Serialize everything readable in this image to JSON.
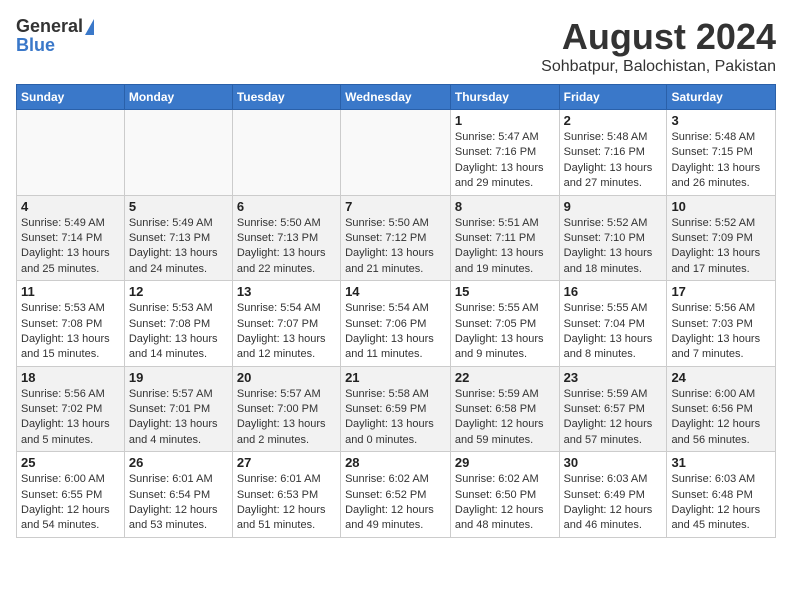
{
  "logo": {
    "general": "General",
    "blue": "Blue"
  },
  "title": "August 2024",
  "subtitle": "Sohbatpur, Balochistan, Pakistan",
  "headers": [
    "Sunday",
    "Monday",
    "Tuesday",
    "Wednesday",
    "Thursday",
    "Friday",
    "Saturday"
  ],
  "weeks": [
    [
      {
        "day": "",
        "sunrise": "",
        "sunset": "",
        "daylight": ""
      },
      {
        "day": "",
        "sunrise": "",
        "sunset": "",
        "daylight": ""
      },
      {
        "day": "",
        "sunrise": "",
        "sunset": "",
        "daylight": ""
      },
      {
        "day": "",
        "sunrise": "",
        "sunset": "",
        "daylight": ""
      },
      {
        "day": "1",
        "sunrise": "Sunrise: 5:47 AM",
        "sunset": "Sunset: 7:16 PM",
        "daylight": "Daylight: 13 hours and 29 minutes."
      },
      {
        "day": "2",
        "sunrise": "Sunrise: 5:48 AM",
        "sunset": "Sunset: 7:16 PM",
        "daylight": "Daylight: 13 hours and 27 minutes."
      },
      {
        "day": "3",
        "sunrise": "Sunrise: 5:48 AM",
        "sunset": "Sunset: 7:15 PM",
        "daylight": "Daylight: 13 hours and 26 minutes."
      }
    ],
    [
      {
        "day": "4",
        "sunrise": "Sunrise: 5:49 AM",
        "sunset": "Sunset: 7:14 PM",
        "daylight": "Daylight: 13 hours and 25 minutes."
      },
      {
        "day": "5",
        "sunrise": "Sunrise: 5:49 AM",
        "sunset": "Sunset: 7:13 PM",
        "daylight": "Daylight: 13 hours and 24 minutes."
      },
      {
        "day": "6",
        "sunrise": "Sunrise: 5:50 AM",
        "sunset": "Sunset: 7:13 PM",
        "daylight": "Daylight: 13 hours and 22 minutes."
      },
      {
        "day": "7",
        "sunrise": "Sunrise: 5:50 AM",
        "sunset": "Sunset: 7:12 PM",
        "daylight": "Daylight: 13 hours and 21 minutes."
      },
      {
        "day": "8",
        "sunrise": "Sunrise: 5:51 AM",
        "sunset": "Sunset: 7:11 PM",
        "daylight": "Daylight: 13 hours and 19 minutes."
      },
      {
        "day": "9",
        "sunrise": "Sunrise: 5:52 AM",
        "sunset": "Sunset: 7:10 PM",
        "daylight": "Daylight: 13 hours and 18 minutes."
      },
      {
        "day": "10",
        "sunrise": "Sunrise: 5:52 AM",
        "sunset": "Sunset: 7:09 PM",
        "daylight": "Daylight: 13 hours and 17 minutes."
      }
    ],
    [
      {
        "day": "11",
        "sunrise": "Sunrise: 5:53 AM",
        "sunset": "Sunset: 7:08 PM",
        "daylight": "Daylight: 13 hours and 15 minutes."
      },
      {
        "day": "12",
        "sunrise": "Sunrise: 5:53 AM",
        "sunset": "Sunset: 7:08 PM",
        "daylight": "Daylight: 13 hours and 14 minutes."
      },
      {
        "day": "13",
        "sunrise": "Sunrise: 5:54 AM",
        "sunset": "Sunset: 7:07 PM",
        "daylight": "Daylight: 13 hours and 12 minutes."
      },
      {
        "day": "14",
        "sunrise": "Sunrise: 5:54 AM",
        "sunset": "Sunset: 7:06 PM",
        "daylight": "Daylight: 13 hours and 11 minutes."
      },
      {
        "day": "15",
        "sunrise": "Sunrise: 5:55 AM",
        "sunset": "Sunset: 7:05 PM",
        "daylight": "Daylight: 13 hours and 9 minutes."
      },
      {
        "day": "16",
        "sunrise": "Sunrise: 5:55 AM",
        "sunset": "Sunset: 7:04 PM",
        "daylight": "Daylight: 13 hours and 8 minutes."
      },
      {
        "day": "17",
        "sunrise": "Sunrise: 5:56 AM",
        "sunset": "Sunset: 7:03 PM",
        "daylight": "Daylight: 13 hours and 7 minutes."
      }
    ],
    [
      {
        "day": "18",
        "sunrise": "Sunrise: 5:56 AM",
        "sunset": "Sunset: 7:02 PM",
        "daylight": "Daylight: 13 hours and 5 minutes."
      },
      {
        "day": "19",
        "sunrise": "Sunrise: 5:57 AM",
        "sunset": "Sunset: 7:01 PM",
        "daylight": "Daylight: 13 hours and 4 minutes."
      },
      {
        "day": "20",
        "sunrise": "Sunrise: 5:57 AM",
        "sunset": "Sunset: 7:00 PM",
        "daylight": "Daylight: 13 hours and 2 minutes."
      },
      {
        "day": "21",
        "sunrise": "Sunrise: 5:58 AM",
        "sunset": "Sunset: 6:59 PM",
        "daylight": "Daylight: 13 hours and 0 minutes."
      },
      {
        "day": "22",
        "sunrise": "Sunrise: 5:59 AM",
        "sunset": "Sunset: 6:58 PM",
        "daylight": "Daylight: 12 hours and 59 minutes."
      },
      {
        "day": "23",
        "sunrise": "Sunrise: 5:59 AM",
        "sunset": "Sunset: 6:57 PM",
        "daylight": "Daylight: 12 hours and 57 minutes."
      },
      {
        "day": "24",
        "sunrise": "Sunrise: 6:00 AM",
        "sunset": "Sunset: 6:56 PM",
        "daylight": "Daylight: 12 hours and 56 minutes."
      }
    ],
    [
      {
        "day": "25",
        "sunrise": "Sunrise: 6:00 AM",
        "sunset": "Sunset: 6:55 PM",
        "daylight": "Daylight: 12 hours and 54 minutes."
      },
      {
        "day": "26",
        "sunrise": "Sunrise: 6:01 AM",
        "sunset": "Sunset: 6:54 PM",
        "daylight": "Daylight: 12 hours and 53 minutes."
      },
      {
        "day": "27",
        "sunrise": "Sunrise: 6:01 AM",
        "sunset": "Sunset: 6:53 PM",
        "daylight": "Daylight: 12 hours and 51 minutes."
      },
      {
        "day": "28",
        "sunrise": "Sunrise: 6:02 AM",
        "sunset": "Sunset: 6:52 PM",
        "daylight": "Daylight: 12 hours and 49 minutes."
      },
      {
        "day": "29",
        "sunrise": "Sunrise: 6:02 AM",
        "sunset": "Sunset: 6:50 PM",
        "daylight": "Daylight: 12 hours and 48 minutes."
      },
      {
        "day": "30",
        "sunrise": "Sunrise: 6:03 AM",
        "sunset": "Sunset: 6:49 PM",
        "daylight": "Daylight: 12 hours and 46 minutes."
      },
      {
        "day": "31",
        "sunrise": "Sunrise: 6:03 AM",
        "sunset": "Sunset: 6:48 PM",
        "daylight": "Daylight: 12 hours and 45 minutes."
      }
    ]
  ]
}
